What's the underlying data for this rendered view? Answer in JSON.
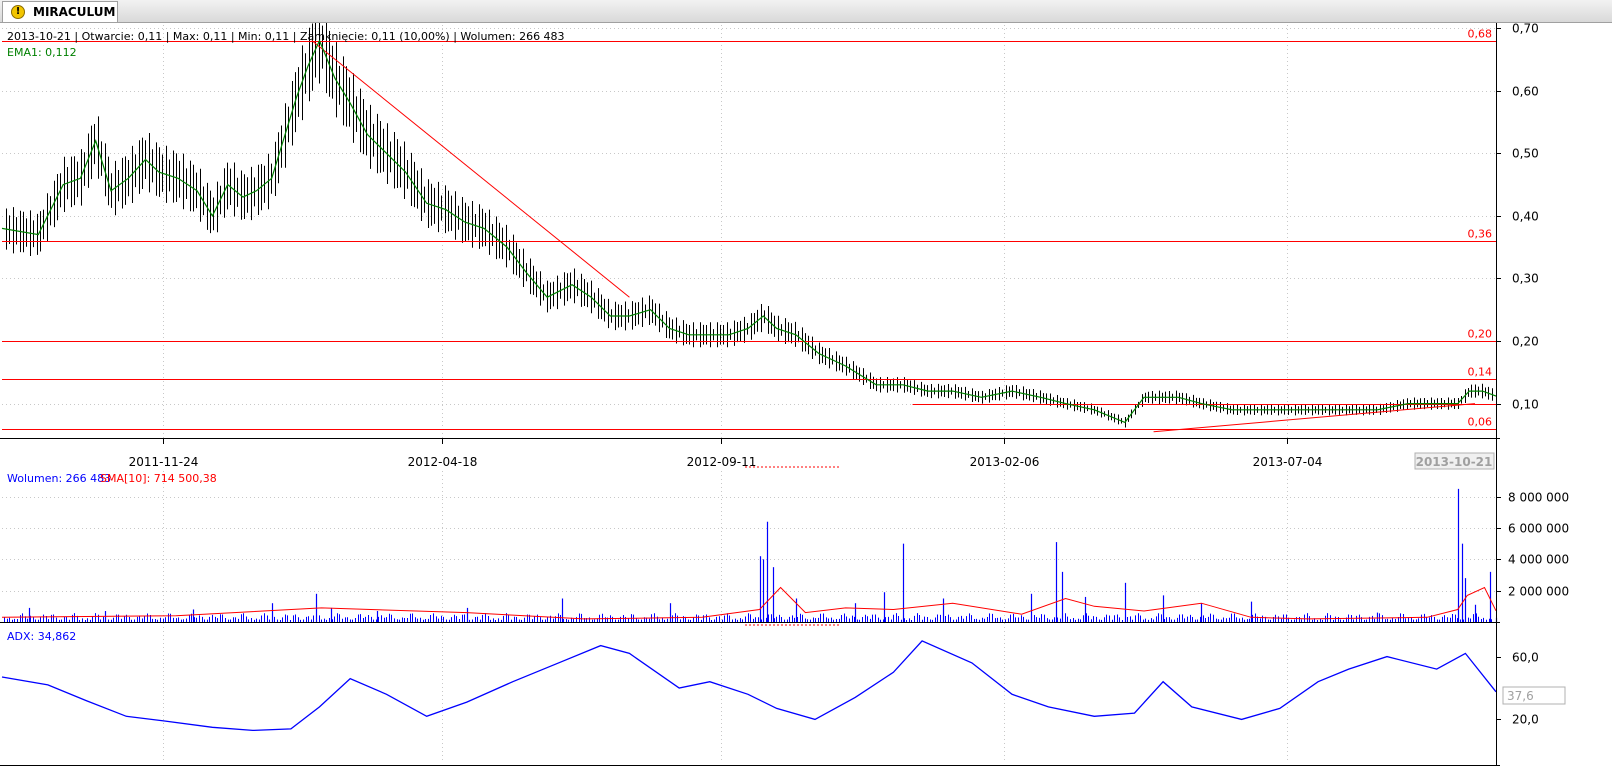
{
  "tab": {
    "title": "MIRACULUM",
    "icon": "warning-icon"
  },
  "info": {
    "date": "2013-10-21",
    "open": "Otwarcie: 0,11",
    "max": "Max: 0,11",
    "min": "Min: 0,11",
    "close": "Zamknięcie: 0,11 (10,00%)",
    "volume": "Wolumen: 266 483",
    "ema": "EMA1: 0,112"
  },
  "volume_header": {
    "volume": "Wolumen: 266 483",
    "sma": "SMA[10]: 714 500,38"
  },
  "adx_header": "ADX: 34,862",
  "adx_current": "37,6",
  "current_date": "2013-10-21",
  "colors": {
    "price": "#000000",
    "ema": "#008000",
    "lines": "#ff0000",
    "volume": "#0000ff",
    "sma": "#ff0000",
    "adx": "#0000ff",
    "grid": "#c8c8c8"
  },
  "chart_data": [
    {
      "type": "line",
      "panel": "price",
      "x_ticks": [
        "2011-11-24",
        "2012-04-18",
        "2012-09-11",
        "2013-02-06",
        "2013-07-04"
      ],
      "y_ticks": [
        "0,10",
        "0,20",
        "0,30",
        "0,40",
        "0,50",
        "0,60",
        "0,70"
      ],
      "ylim": [
        0.045,
        0.705
      ],
      "horizontal_levels": [
        {
          "value": 0.68,
          "label": "0,68"
        },
        {
          "value": 0.36,
          "label": "0,36"
        },
        {
          "value": 0.2,
          "label": "0,20"
        },
        {
          "value": 0.14,
          "label": "0,14"
        },
        {
          "value": 0.06,
          "label": "0,06"
        }
      ],
      "support_line": {
        "value": 0.1,
        "from": "2012-12-20",
        "to": "2013-10-21"
      },
      "trendlines": [
        {
          "from": [
            "2012-02-10",
            0.68
          ],
          "to": [
            "2012-07-25",
            0.27
          ]
        },
        {
          "from": [
            "2013-04-25",
            0.055
          ],
          "to": [
            "2013-10-10",
            0.1
          ]
        }
      ],
      "series": [
        {
          "name": "EMA1",
          "dates": [
            "2011-09-01",
            "2011-09-20",
            "2011-10-03",
            "2011-10-12",
            "2011-10-20",
            "2011-10-28",
            "2011-11-06",
            "2011-11-15",
            "2011-11-22",
            "2011-12-02",
            "2011-12-12",
            "2011-12-20",
            "2011-12-28",
            "2012-01-05",
            "2012-01-12",
            "2012-01-20",
            "2012-01-27",
            "2012-02-02",
            "2012-02-08",
            "2012-02-14",
            "2012-02-22",
            "2012-03-01",
            "2012-03-10",
            "2012-03-20",
            "2012-03-30",
            "2012-04-10",
            "2012-04-20",
            "2012-04-30",
            "2012-05-10",
            "2012-05-22",
            "2012-06-01",
            "2012-06-12",
            "2012-06-25",
            "2012-07-05",
            "2012-07-15",
            "2012-07-25",
            "2012-08-05",
            "2012-08-15",
            "2012-08-25",
            "2012-09-05",
            "2012-09-15",
            "2012-09-25",
            "2012-10-03",
            "2012-10-10",
            "2012-10-20",
            "2012-11-01",
            "2012-11-15",
            "2012-12-01",
            "2012-12-15",
            "2012-12-28",
            "2013-01-10",
            "2013-01-25",
            "2013-02-10",
            "2013-02-25",
            "2013-03-10",
            "2013-03-25",
            "2013-04-10",
            "2013-04-20",
            "2013-04-27",
            "2013-05-08",
            "2013-05-20",
            "2013-06-05",
            "2013-06-20",
            "2013-07-05",
            "2013-07-20",
            "2013-08-05",
            "2013-08-20",
            "2013-09-05",
            "2013-09-20",
            "2013-10-01",
            "2013-10-07",
            "2013-10-14",
            "2013-10-21"
          ],
          "values": [
            0.38,
            0.37,
            0.45,
            0.46,
            0.52,
            0.44,
            0.46,
            0.49,
            0.47,
            0.46,
            0.44,
            0.4,
            0.45,
            0.43,
            0.44,
            0.46,
            0.53,
            0.59,
            0.64,
            0.68,
            0.62,
            0.58,
            0.53,
            0.5,
            0.47,
            0.42,
            0.41,
            0.39,
            0.38,
            0.35,
            0.31,
            0.27,
            0.29,
            0.27,
            0.24,
            0.24,
            0.25,
            0.22,
            0.21,
            0.21,
            0.21,
            0.22,
            0.24,
            0.22,
            0.21,
            0.18,
            0.16,
            0.13,
            0.13,
            0.12,
            0.12,
            0.11,
            0.12,
            0.11,
            0.1,
            0.09,
            0.07,
            0.11,
            0.11,
            0.11,
            0.1,
            0.09,
            0.09,
            0.09,
            0.09,
            0.09,
            0.09,
            0.1,
            0.1,
            0.1,
            0.12,
            0.12,
            0.112
          ]
        }
      ]
    },
    {
      "type": "bar",
      "panel": "volume",
      "y_ticks": [
        "2 000 000",
        "4 000 000",
        "6 000 000",
        "8 000 000"
      ],
      "ylim": [
        0,
        9000000
      ],
      "series": [
        {
          "name": "Wolumen",
          "dates": [
            "2011-09-15",
            "2011-10-25",
            "2011-12-10",
            "2012-01-20",
            "2012-02-12",
            "2012-02-20",
            "2012-03-15",
            "2012-05-01",
            "2012-06-20",
            "2012-08-15",
            "2012-10-01",
            "2012-10-03",
            "2012-10-05",
            "2012-10-08",
            "2012-10-20",
            "2012-11-20",
            "2012-12-05",
            "2012-12-15",
            "2013-01-05",
            "2013-02-20",
            "2013-03-05",
            "2013-03-08",
            "2013-03-20",
            "2013-04-10",
            "2013-04-30",
            "2013-05-20",
            "2013-06-15",
            "2013-08-20",
            "2013-10-01",
            "2013-10-03",
            "2013-10-05",
            "2013-10-10",
            "2013-10-18",
            "2013-10-21"
          ],
          "values": [
            900000,
            700000,
            800000,
            1200000,
            1800000,
            900000,
            700000,
            900000,
            1500000,
            1200000,
            4200000,
            4000000,
            6400000,
            3500000,
            1500000,
            1200000,
            1900000,
            5000000,
            1500000,
            1800000,
            5100000,
            3200000,
            1600000,
            2500000,
            1700000,
            1200000,
            1300000,
            600000,
            8500000,
            5000000,
            2800000,
            1100000,
            3200000,
            266483
          ]
        },
        {
          "name": "SMA[10]",
          "dates": [
            "2011-09-01",
            "2011-12-01",
            "2012-02-15",
            "2012-05-01",
            "2012-07-01",
            "2012-09-01",
            "2012-10-01",
            "2012-10-12",
            "2012-10-25",
            "2012-11-15",
            "2012-12-10",
            "2013-01-10",
            "2013-02-15",
            "2013-03-10",
            "2013-03-25",
            "2013-04-20",
            "2013-05-20",
            "2013-06-15",
            "2013-07-15",
            "2013-09-15",
            "2013-10-01",
            "2013-10-06",
            "2013-10-15",
            "2013-10-21"
          ],
          "values": [
            300000,
            400000,
            900000,
            600000,
            200000,
            300000,
            800000,
            2200000,
            600000,
            900000,
            800000,
            1200000,
            500000,
            1500000,
            1000000,
            700000,
            1200000,
            300000,
            200000,
            300000,
            800000,
            1700000,
            2200000,
            714500
          ]
        }
      ]
    },
    {
      "type": "line",
      "panel": "adx",
      "y_ticks": [
        "20,0",
        "60,0"
      ],
      "ylim": [
        5,
        75
      ],
      "series": [
        {
          "name": "ADX",
          "dates": [
            "2011-09-01",
            "2011-09-25",
            "2011-10-15",
            "2011-11-05",
            "2011-11-25",
            "2011-12-20",
            "2012-01-10",
            "2012-01-30",
            "2012-02-14",
            "2012-03-01",
            "2012-03-20",
            "2012-04-10",
            "2012-05-01",
            "2012-05-25",
            "2012-06-20",
            "2012-07-10",
            "2012-07-25",
            "2012-08-20",
            "2012-09-05",
            "2012-09-25",
            "2012-10-10",
            "2012-10-30",
            "2012-11-20",
            "2012-12-10",
            "2012-12-25",
            "2013-01-20",
            "2013-02-10",
            "2013-03-01",
            "2013-03-25",
            "2013-04-15",
            "2013-04-30",
            "2013-05-15",
            "2013-06-10",
            "2013-06-30",
            "2013-07-20",
            "2013-08-05",
            "2013-08-25",
            "2013-09-20",
            "2013-10-05",
            "2013-10-21"
          ],
          "values": [
            47,
            42,
            32,
            22,
            19,
            15,
            13,
            14,
            28,
            46,
            36,
            22,
            31,
            44,
            57,
            67,
            62,
            40,
            44,
            36,
            27,
            20,
            34,
            50,
            70,
            56,
            36,
            28,
            22,
            24,
            44,
            28,
            20,
            27,
            44,
            52,
            60,
            52,
            62,
            37.6
          ]
        }
      ]
    }
  ]
}
